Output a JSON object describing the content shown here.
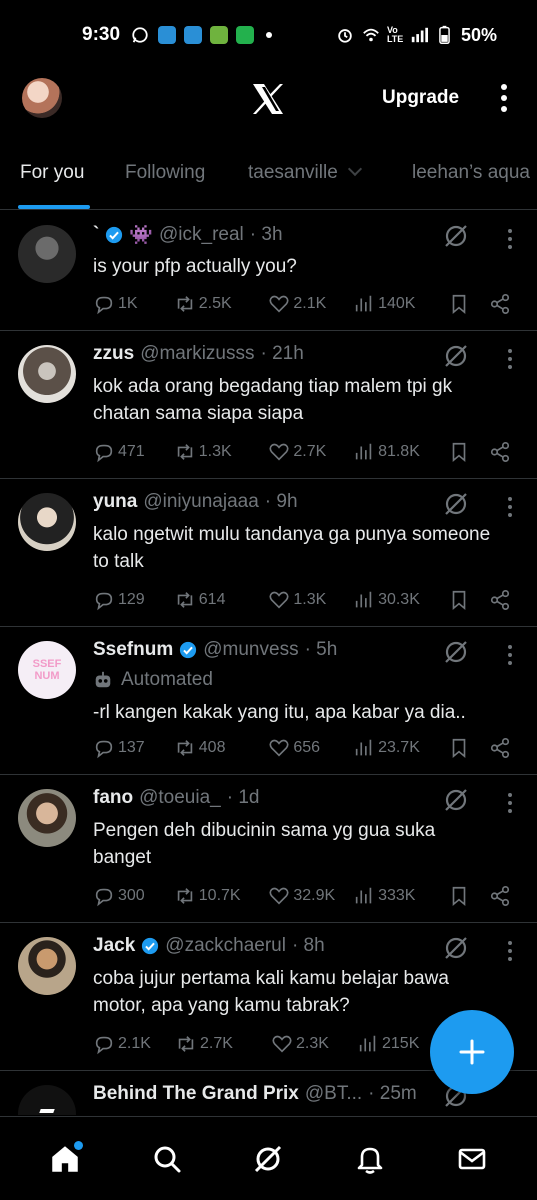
{
  "status_bar": {
    "time": "9:30",
    "battery": "50%",
    "icons": [
      "whatsapp-icon",
      "shopee-icon",
      "shopee-icon",
      "game-icon",
      "line-icon",
      "dot-icon",
      "alarm-icon",
      "wifi-icon",
      "volte-icon",
      "signal-icon",
      "battery-icon"
    ]
  },
  "header": {
    "logo": "x-logo-icon",
    "upgrade_label": "Upgrade"
  },
  "tabs": [
    {
      "label": "For you",
      "active": true
    },
    {
      "label": "Following",
      "active": false
    },
    {
      "label": "taesanville",
      "active": false
    },
    {
      "label": "leehan’s aqua",
      "active": false
    }
  ],
  "posts": [
    {
      "name": "`",
      "verified": true,
      "emoji": "👾",
      "handle": "@ick_real",
      "time": "· 3h",
      "text": "is your pfp actually you?",
      "replies": "1K",
      "reposts": "2.5K",
      "likes": "2.1K",
      "views": "140K",
      "avatar_color": "#3a3a3a"
    },
    {
      "name": "zzus",
      "verified": false,
      "handle": "@markizusss",
      "time": "· 21h",
      "text": "kok ada orang begadang tiap malem tpi gk chatan sama siapa siapa",
      "replies": "471",
      "reposts": "1.3K",
      "likes": "2.7K",
      "views": "81.8K",
      "avatar_color": "#5b5048"
    },
    {
      "name": "yuna",
      "verified": false,
      "handle": "@iniyunajaaa",
      "time": "· 9h",
      "text": "kalo ngetwit mulu tandanya ga punya someone to talk",
      "replies": "129",
      "reposts": "614",
      "likes": "1.3K",
      "views": "30.3K",
      "avatar_color": "#d7d0c4"
    },
    {
      "name": "Ssefnum",
      "verified": true,
      "handle": "@munvess",
      "time": "· 5h",
      "automated_label": "Automated",
      "text": "-rl kangen kakak yang itu, apa kabar ya dia..",
      "replies": "137",
      "reposts": "408",
      "likes": "656",
      "views": "23.7K",
      "avatar_text": "SSEF NUM",
      "avatar_color": "#f5eef6"
    },
    {
      "name": "fano",
      "verified": false,
      "handle": "@toeuia_",
      "time": "· 1d",
      "text": "Pengen deh dibucinin sama yg gua suka banget",
      "replies": "300",
      "reposts": "10.7K",
      "likes": "32.9K",
      "views": "333K",
      "avatar_color": "#8c8a7e"
    },
    {
      "name": "Jack",
      "verified": true,
      "handle": "@zackchaerul",
      "time": "· 8h",
      "text": "coba jujur pertama kali kamu belajar bawa motor, apa yang kamu tabrak?",
      "replies": "2.1K",
      "reposts": "2.7K",
      "likes": "2.3K",
      "views": "215K",
      "avatar_color": "#b8a58a"
    },
    {
      "name": "Behind The Grand Prix",
      "verified": false,
      "handle": "@BT...",
      "time": "· 25m",
      "avatar_color": "#111111"
    }
  ],
  "compose": {
    "icon": "plus-icon"
  },
  "bottom_nav": [
    "home-icon",
    "search-icon",
    "grok-icon",
    "notifications-icon",
    "messages-icon"
  ],
  "colors": {
    "accent": "#1d9bf0",
    "muted": "#71767b",
    "divider": "#2f3336",
    "background": "#000000"
  }
}
